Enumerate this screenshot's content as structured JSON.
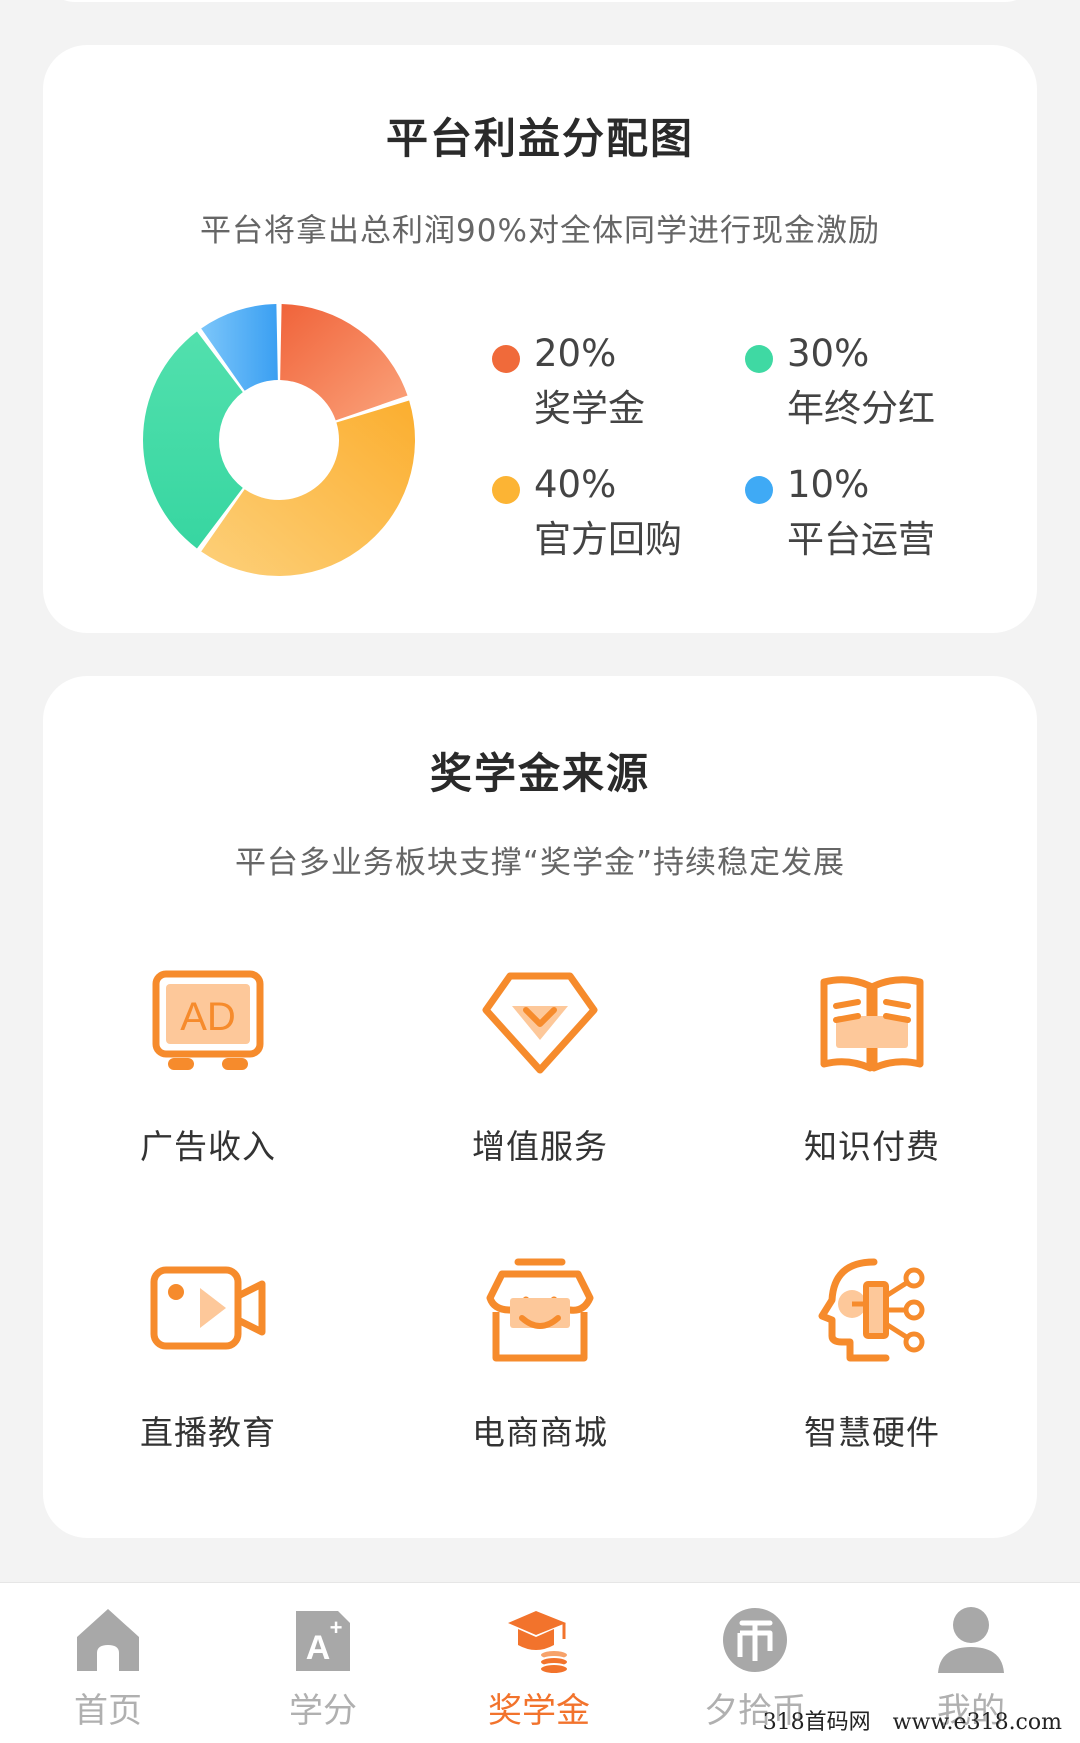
{
  "card1": {
    "title": "平台利益分配图",
    "subtitle": "平台将拿出总利润90%对全体同学进行现金激励"
  },
  "chart_data": {
    "type": "pie",
    "donut": true,
    "series": [
      {
        "label": "奖学金",
        "value": 20,
        "percent_text": "20%",
        "color": "#f06a3a"
      },
      {
        "label": "官方回购",
        "value": 40,
        "percent_text": "40%",
        "color": "#fcb434"
      },
      {
        "label": "年终分红",
        "value": 30,
        "percent_text": "30%",
        "color": "#3fd9a3"
      },
      {
        "label": "平台运营",
        "value": 10,
        "percent_text": "10%",
        "color": "#3faaf5"
      }
    ],
    "legend_placement": "right"
  },
  "card2": {
    "title": "奖学金来源",
    "subtitle": "平台多业务板块支撑“奖学金”持续稳定发展",
    "items": [
      {
        "label": "广告收入",
        "icon": "ad-icon"
      },
      {
        "label": "增值服务",
        "icon": "diamond-icon"
      },
      {
        "label": "知识付费",
        "icon": "book-icon"
      },
      {
        "label": "直播教育",
        "icon": "video-camera-icon"
      },
      {
        "label": "电商商城",
        "icon": "store-icon"
      },
      {
        "label": "智慧硬件",
        "icon": "ai-head-icon"
      }
    ],
    "icon_color": "#f68b2c"
  },
  "tabbar": {
    "tabs": [
      {
        "label": "首页",
        "icon": "home-icon",
        "active": false
      },
      {
        "label": "学分",
        "icon": "credit-icon",
        "active": false
      },
      {
        "label": "奖学金",
        "icon": "scholarship-icon",
        "active": true
      },
      {
        "label": "夕拾币",
        "icon": "coin-icon",
        "active": false
      },
      {
        "label": "我的",
        "icon": "user-icon",
        "active": false
      }
    ],
    "active_color": "#f2732c",
    "inactive_color": "#b0b0b0"
  },
  "watermark": "318首码网　www.e318.com"
}
